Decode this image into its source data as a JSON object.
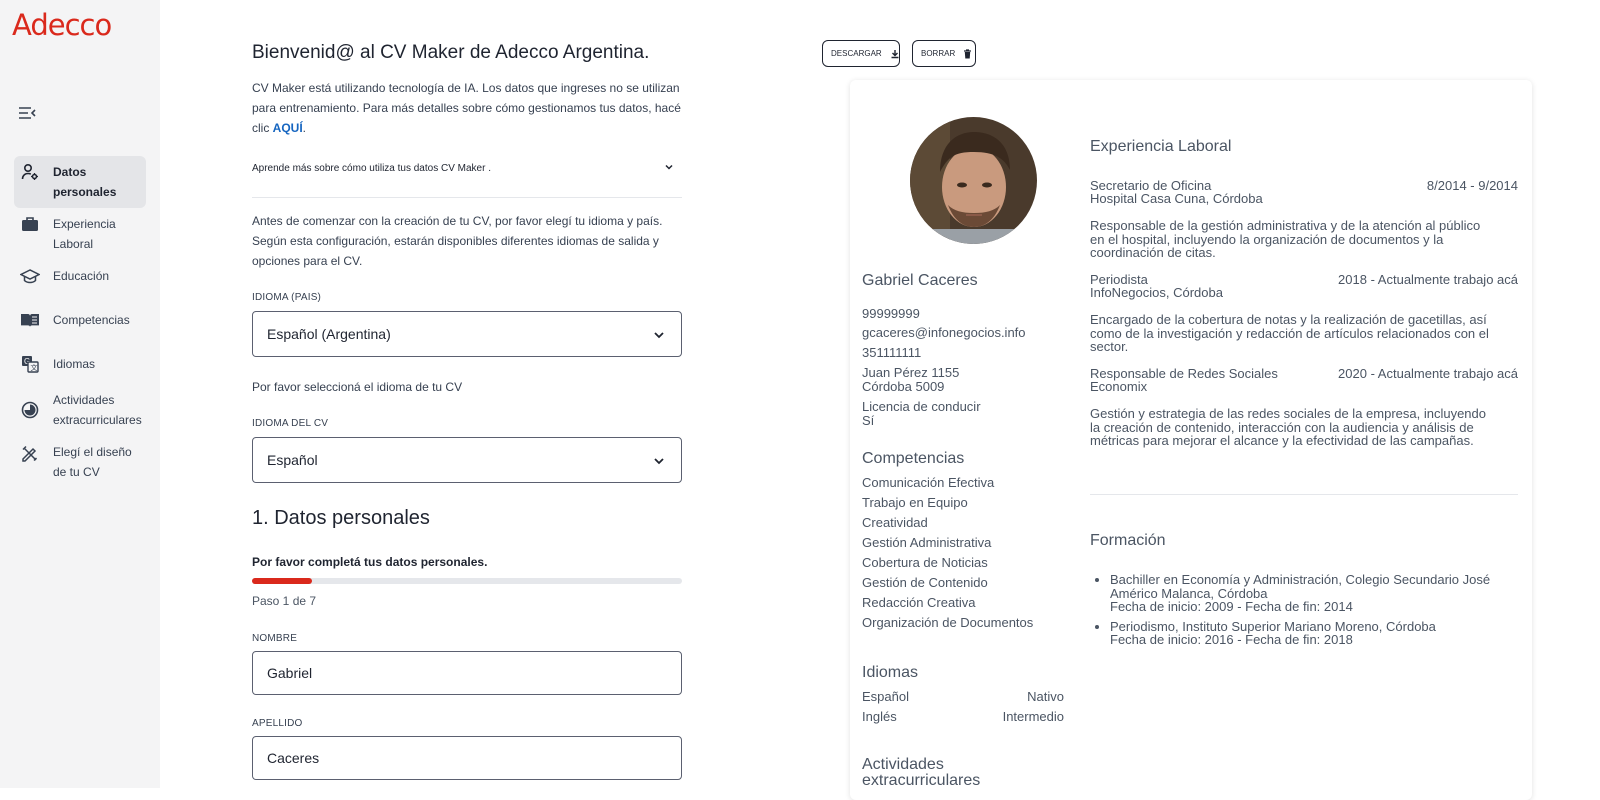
{
  "brand": {
    "logo_text": "Adecco",
    "color": "#da291c",
    "link_color": "#1565c0"
  },
  "sidebar": {
    "items": [
      {
        "label": "Datos personales",
        "icon": "person-settings-icon",
        "active": true
      },
      {
        "label": "Experiencia Laboral",
        "icon": "briefcase-icon",
        "active": false
      },
      {
        "label": "Educación",
        "icon": "graduation-cap-icon",
        "active": false
      },
      {
        "label": "Competencias",
        "icon": "book-icon",
        "active": false
      },
      {
        "label": "Idiomas",
        "icon": "translate-icon",
        "active": false
      },
      {
        "label": "Actividades extracurriculares",
        "icon": "badge-icon",
        "active": false
      },
      {
        "label": "Elegí el diseño de tu CV",
        "icon": "design-tools-icon",
        "active": false
      }
    ]
  },
  "main": {
    "title": "Bienvenid@ al CV Maker de Adecco Argentina.",
    "intro_text": "CV Maker está utilizando tecnología de IA. Los datos que ingreses no se utilizan para entrenamiento. Para más detalles sobre cómo gestionamos tus datos, hacé clic ",
    "intro_link": "AQUÍ",
    "intro_end": ".",
    "accordion_label": "Aprende más sobre cómo utiliza tus datos CV Maker .",
    "config_text": "Antes de comenzar con la creación de tu CV, por favor elegí tu idioma y país. Según esta configuración, estarán disponibles diferentes idiomas de salida y opciones para el CV.",
    "country_label": "IDIOMA (PAIS)",
    "country_value": "Español (Argentina)",
    "cv_lang_hint": "Por favor seleccioná el idioma de tu CV",
    "cv_lang_label": "IDIOMA DEL CV",
    "cv_lang_value": "Español",
    "section_title": "1. Datos personales",
    "section_sub": "Por favor completá tus datos personales.",
    "progress": 0.14,
    "step_text": "Paso 1 de 7",
    "first_name_label": "NOMBRE",
    "first_name_value": "Gabriel",
    "last_name_label": "APELLIDO",
    "last_name_value": "Caceres"
  },
  "toolbar": {
    "download_label": "DESCARGAR",
    "delete_label": "BORRAR"
  },
  "cv": {
    "name": "Gabriel Caceres",
    "phone1": "99999999",
    "email": "gcaceres@infonegocios.info",
    "phone2": "351111111",
    "address1": "Juan Pérez 1155",
    "address2": "Córdoba 5009",
    "license_label": "Licencia de conducir",
    "license_value": "Sí",
    "skills_title": "Competencias",
    "skills": [
      "Comunicación Efectiva",
      "Trabajo en Equipo",
      "Creatividad",
      "Gestión Administrativa",
      "Cobertura de Noticias",
      "Gestión de Contenido",
      "Redacción Creativa",
      "Organización de Documentos"
    ],
    "languages_title": "Idiomas",
    "languages": [
      {
        "name": "Español",
        "level": "Nativo"
      },
      {
        "name": "Inglés",
        "level": "Intermedio"
      }
    ],
    "activities_title": "Actividades extracurriculares",
    "experience_title": "Experiencia Laboral",
    "jobs": [
      {
        "title": "Secretario de Oficina",
        "dates": "8/2014 - 9/2014",
        "company": "Hospital Casa Cuna, Córdoba",
        "desc": "Responsable de la gestión administrativa y de la atención al público en el hospital, incluyendo la organización de documentos y la coordinación de citas."
      },
      {
        "title": "Periodista",
        "dates": "2018 - Actualmente trabajo acá",
        "company": "InfoNegocios, Córdoba",
        "desc": "Encargado de la cobertura de notas y la realización de gacetillas, así como de la investigación y redacción de artículos relacionados con el sector."
      },
      {
        "title": "Responsable de Redes Sociales",
        "dates": "2020 - Actualmente trabajo acá",
        "company": "Economix",
        "desc": "Gestión y estrategia de las redes sociales de la empresa, incluyendo la creación de contenido, interacción con la audiencia y análisis de métricas para mejorar el alcance y la efectividad de las campañas."
      }
    ],
    "education_title": "Formación",
    "education": [
      {
        "line1": "Bachiller en Economía y Administración, Colegio Secundario José Américo Malanca, Córdoba",
        "line2": "Fecha de inicio: 2009 - Fecha de fin: 2014"
      },
      {
        "line1": "Periodismo, Instituto Superior Mariano Moreno, Córdoba",
        "line2": "Fecha de inicio: 2016 - Fecha de fin: 2018"
      }
    ]
  }
}
